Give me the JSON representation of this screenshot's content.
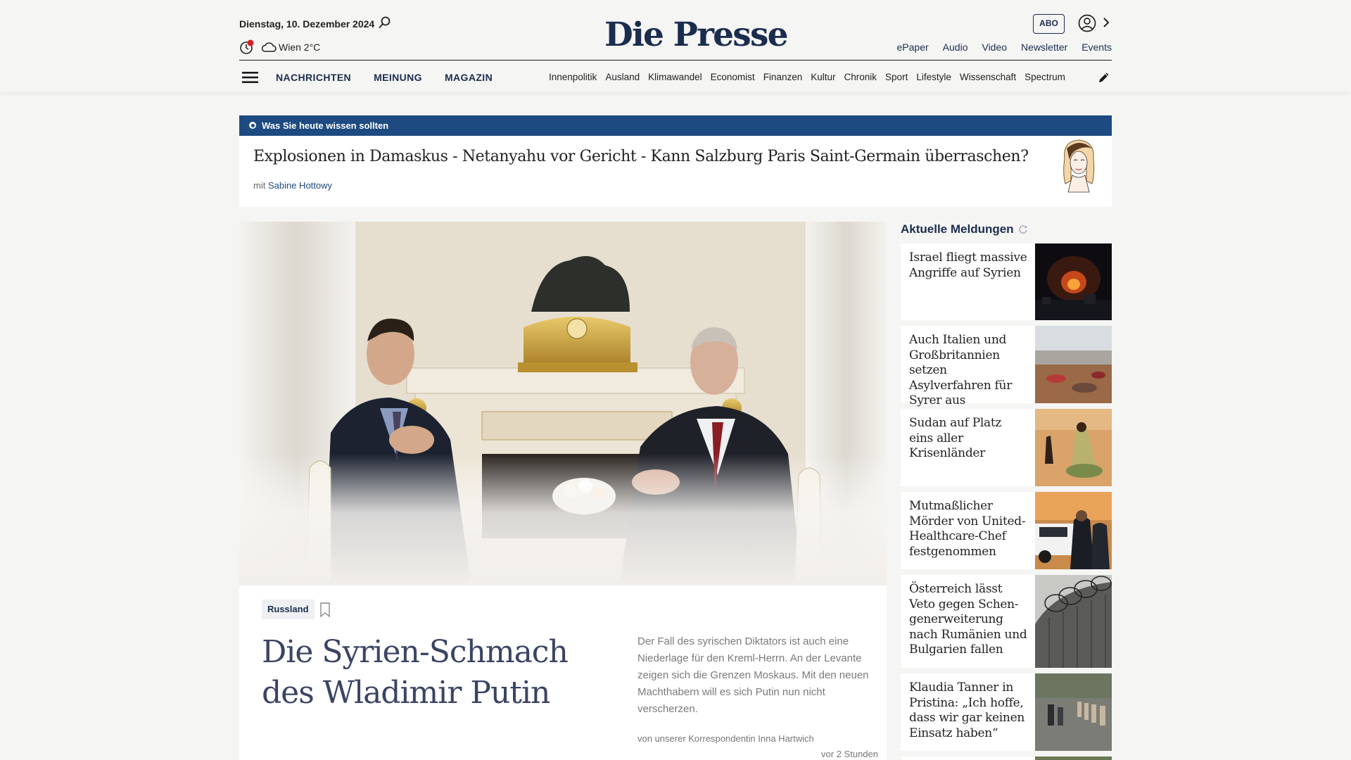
{
  "header": {
    "date": "Dienstag, 10. Dezember 2024",
    "weather": "Wien 2°C",
    "logo": "Die Presse",
    "abo_label": "ABO",
    "top_links": [
      "ePaper",
      "Audio",
      "Video",
      "Newsletter",
      "Events"
    ],
    "main_nav": [
      "NACHRICHTEN",
      "MEINUNG",
      "MAGAZIN"
    ],
    "sub_nav": [
      "Innenpolitik",
      "Ausland",
      "Klimawandel",
      "Economist",
      "Finanzen",
      "Kultur",
      "Chronik",
      "Sport",
      "Lifestyle",
      "Wissenschaft",
      "Spectrum"
    ],
    "accent_color": "#1b2d4e",
    "notification_color": "#d61f26"
  },
  "briefing": {
    "label": "Was Sie heute wissen sollten",
    "title": "Explosionen in Damaskus - Netanyahu vor Gericht - Kann Salzburg Paris Saint-Germain überraschen?",
    "meta_prefix": "mit",
    "author": "Sabine Hottowy",
    "bar_color": "#1d4a80"
  },
  "hero": {
    "image": "meeting-in-kremlin-photo",
    "tag": "Russland",
    "title": "Die Syrien-Schmach des Wladimir Putin",
    "teaser": "Der Fall des syrischen Diktators ist auch eine Niederlage für den Kreml-Herrn. An der Levante zeigen sich die Grenzen Moskaus. Mit den neuen Machthabern will es sich Putin nun nicht verscherzen.",
    "byline": "von unserer Korrespondentin Inna Hartwich",
    "time": "vor 2 Stunden"
  },
  "sidebar": {
    "heading": "Aktuelle Meldungen",
    "items": [
      {
        "title": "Israel fliegt massive Angriffe auf Syrien",
        "thumb": "night-explosion-photo"
      },
      {
        "title": "Auch Italien und Großbritannien setzen Asylverfahren für Syrer aus",
        "thumb": "refugee-camp-photo"
      },
      {
        "title": "Sudan auf Platz eins aller Krisenländer",
        "thumb": "sudan-desert-photo"
      },
      {
        "title": "Mutmaßlicher Mörder von United-Healthcare-Chef festgenommen",
        "thumb": "police-car-photo"
      },
      {
        "title": "Österreich lässt Veto gegen Schen-generweiterung nach Rumänien und Bulgarien fallen",
        "thumb": "barbed-wire-fence-photo"
      },
      {
        "title": "Klaudia Tanner in Pristina: „Ich hoffe, dass wir gar keinen Einsatz haben“",
        "thumb": "troops-parade-photo"
      }
    ]
  }
}
